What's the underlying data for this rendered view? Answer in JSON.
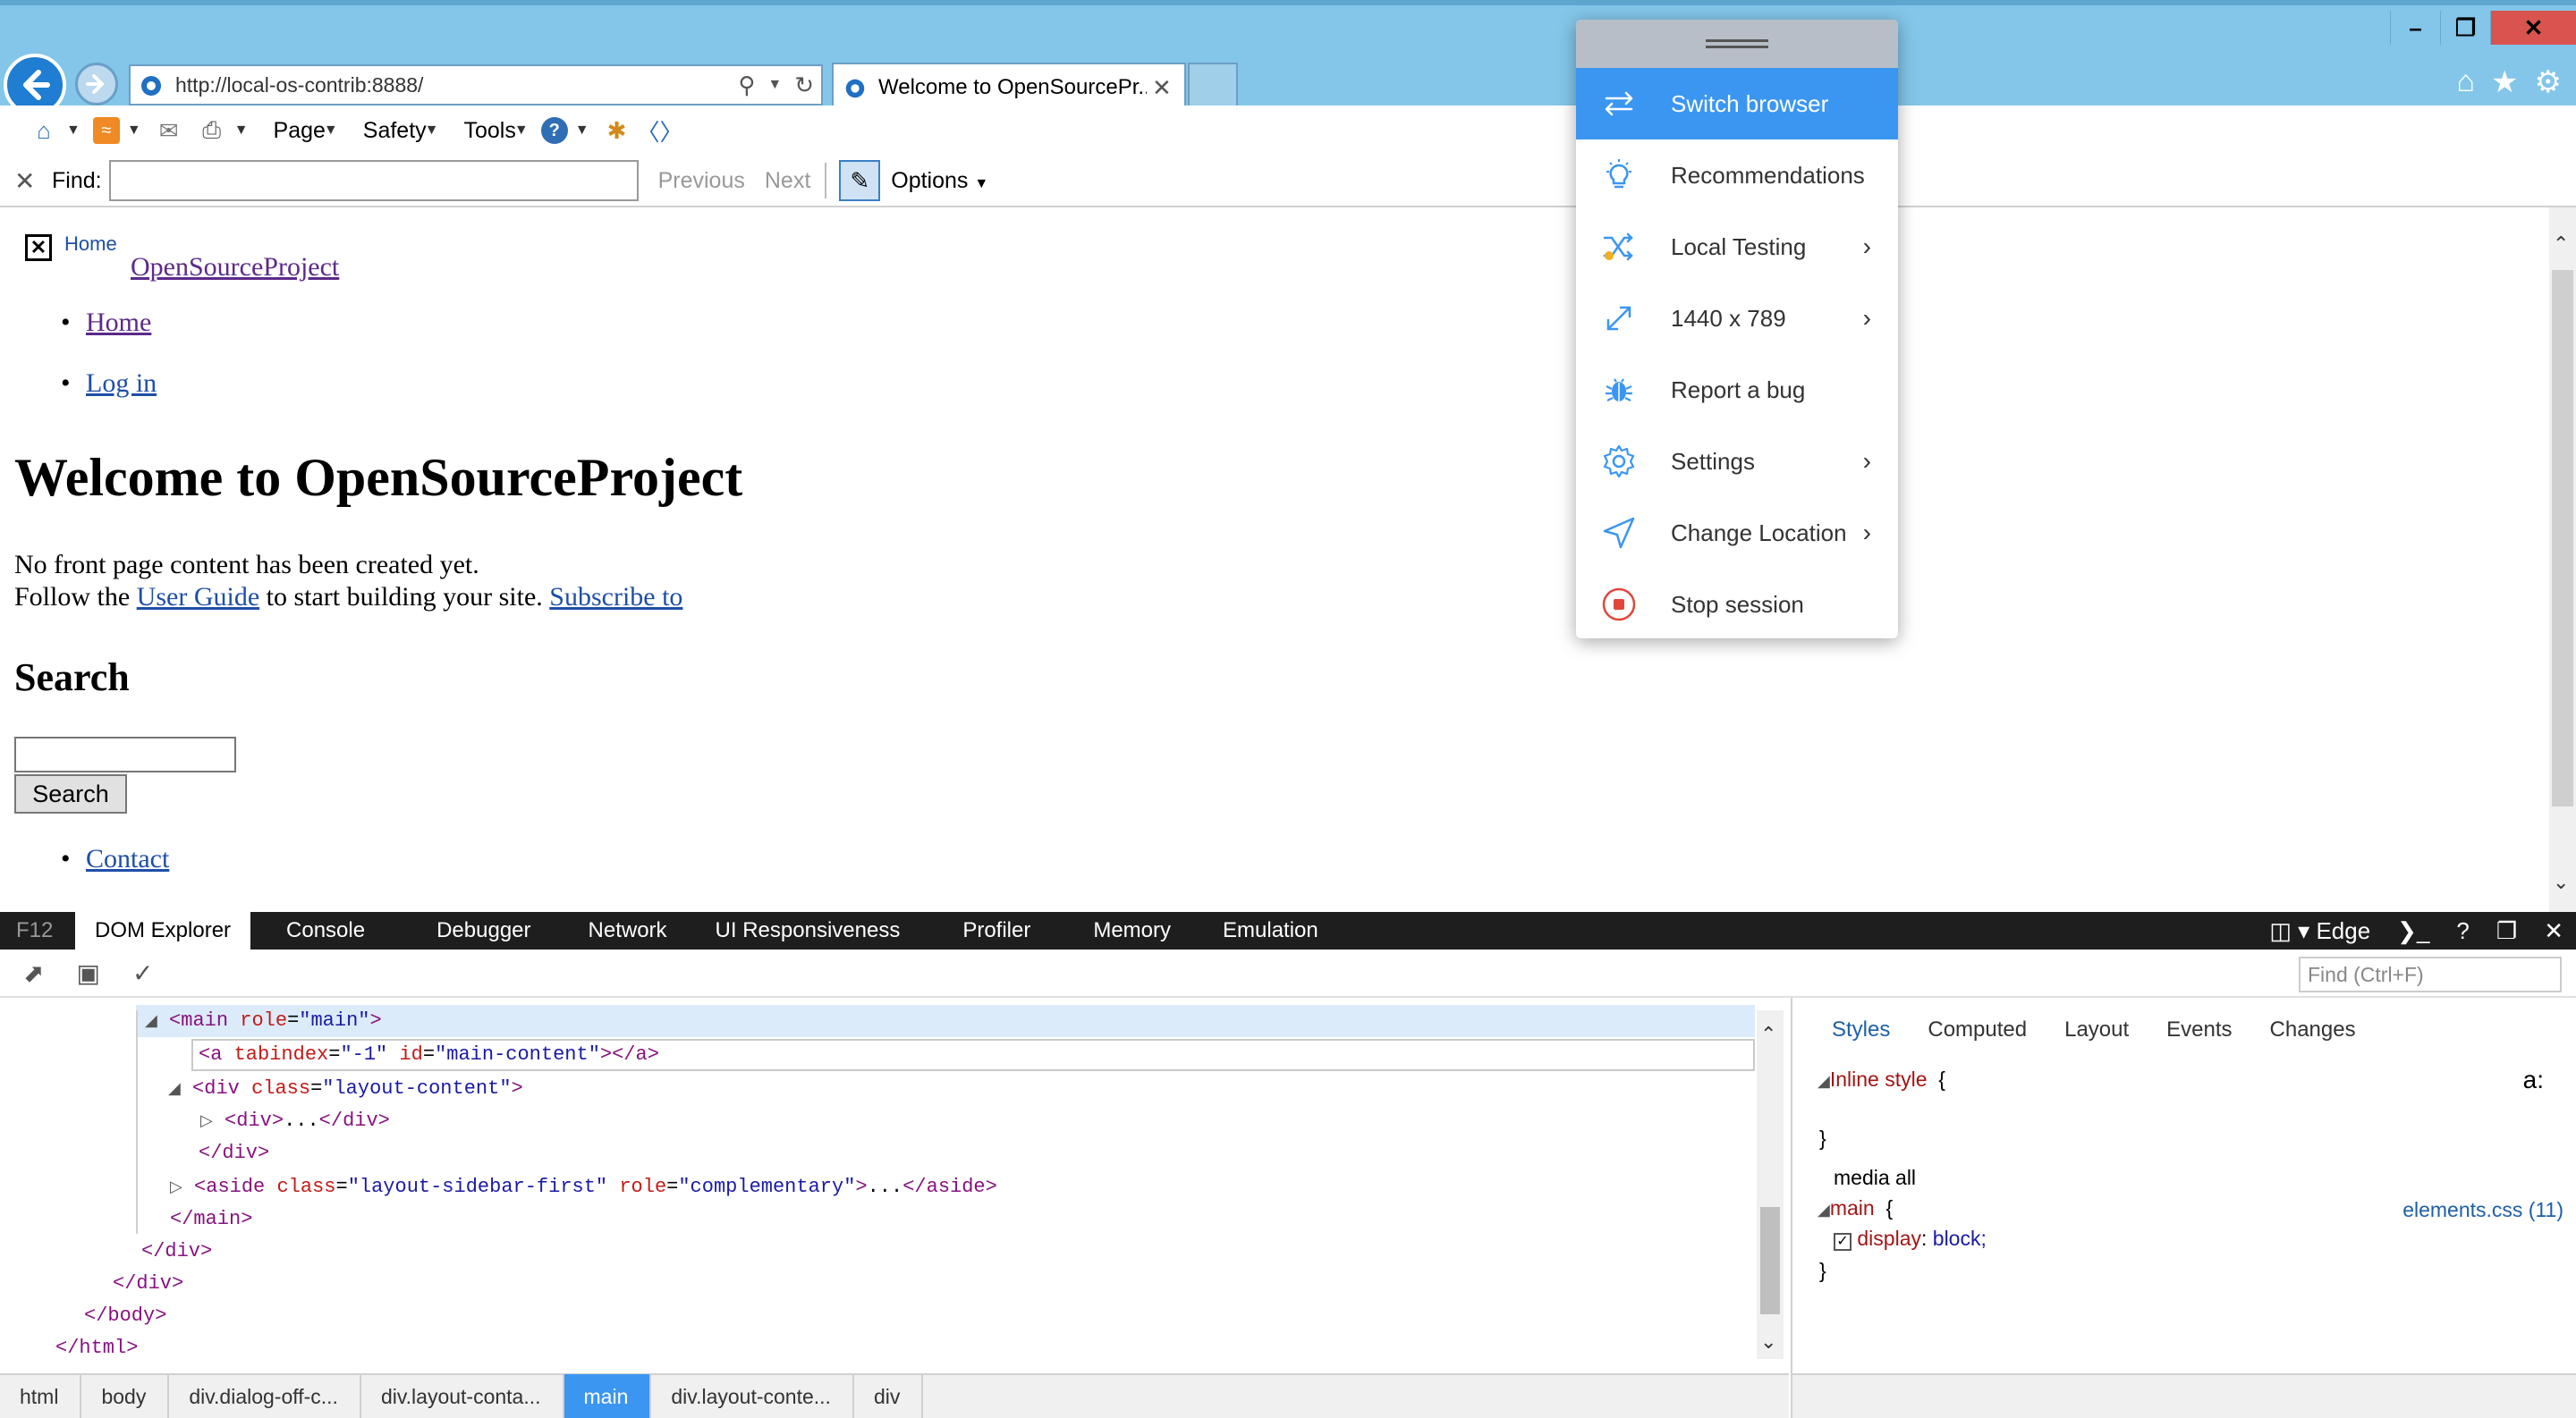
{
  "browser": {
    "address": "http://local-os-contrib:8888/",
    "tab_title": "Welcome to OpenSourcePr...",
    "commands": {
      "page": "Page",
      "safety": "Safety",
      "tools": "Tools"
    },
    "find": {
      "label": "Find:",
      "value": "",
      "previous": "Previous",
      "next": "Next",
      "options": "Options"
    }
  },
  "page": {
    "logo_text": "Home",
    "site_name": "OpenSourceProject",
    "nav": [
      "Home",
      "Log in"
    ],
    "heading": "Welcome to OpenSourceProject",
    "paragraph_line1": "No front page content has been created yet.",
    "paragraph_pre": "Follow the ",
    "user_guide": "User Guide",
    "paragraph_mid": " to start building your site. ",
    "subscribe": "Subscribe to",
    "search_heading": "Search",
    "search_button": "Search",
    "contact": "Contact"
  },
  "menu": {
    "items": [
      {
        "label": "Switch browser",
        "icon": "switch-icon",
        "submenu": false,
        "active": true
      },
      {
        "label": "Recommendations",
        "icon": "lightbulb-icon",
        "submenu": false
      },
      {
        "label": "Local Testing",
        "icon": "shuffle-icon",
        "submenu": true
      },
      {
        "label": "1440 x 789",
        "icon": "resize-icon",
        "submenu": true
      },
      {
        "label": "Report a bug",
        "icon": "bug-icon",
        "submenu": false
      },
      {
        "label": "Settings",
        "icon": "gear-icon",
        "submenu": true
      },
      {
        "label": "Change Location",
        "icon": "location-arrow-icon",
        "submenu": true
      },
      {
        "label": "Stop session",
        "icon": "stop-icon",
        "submenu": false
      }
    ]
  },
  "devtools": {
    "f12": "F12",
    "tabs": [
      "DOM Explorer",
      "Console",
      "Debugger",
      "Network",
      "UI Responsiveness",
      "Profiler",
      "Memory",
      "Emulation"
    ],
    "engine": "Edge",
    "find_placeholder": "Find (Ctrl+F)",
    "breadcrumbs": [
      "html",
      "body",
      "div.dialog-off-c...",
      "div.layout-conta...",
      "main",
      "div.layout-conte...",
      "div"
    ],
    "styles_tabs": [
      "Styles",
      "Computed",
      "Layout",
      "Events",
      "Changes"
    ],
    "styles": {
      "inline_label": "Inline style",
      "open_brace": "{",
      "close_brace": "}",
      "pseudo": "a:",
      "media": "media all",
      "selector": "main",
      "property": "display",
      "value": "block;",
      "source": "elements.css (11)"
    }
  },
  "colors": {
    "accent": "#3b96f2",
    "ie_chrome": "#83c6e9",
    "dev_dark": "#1e1e1e"
  }
}
